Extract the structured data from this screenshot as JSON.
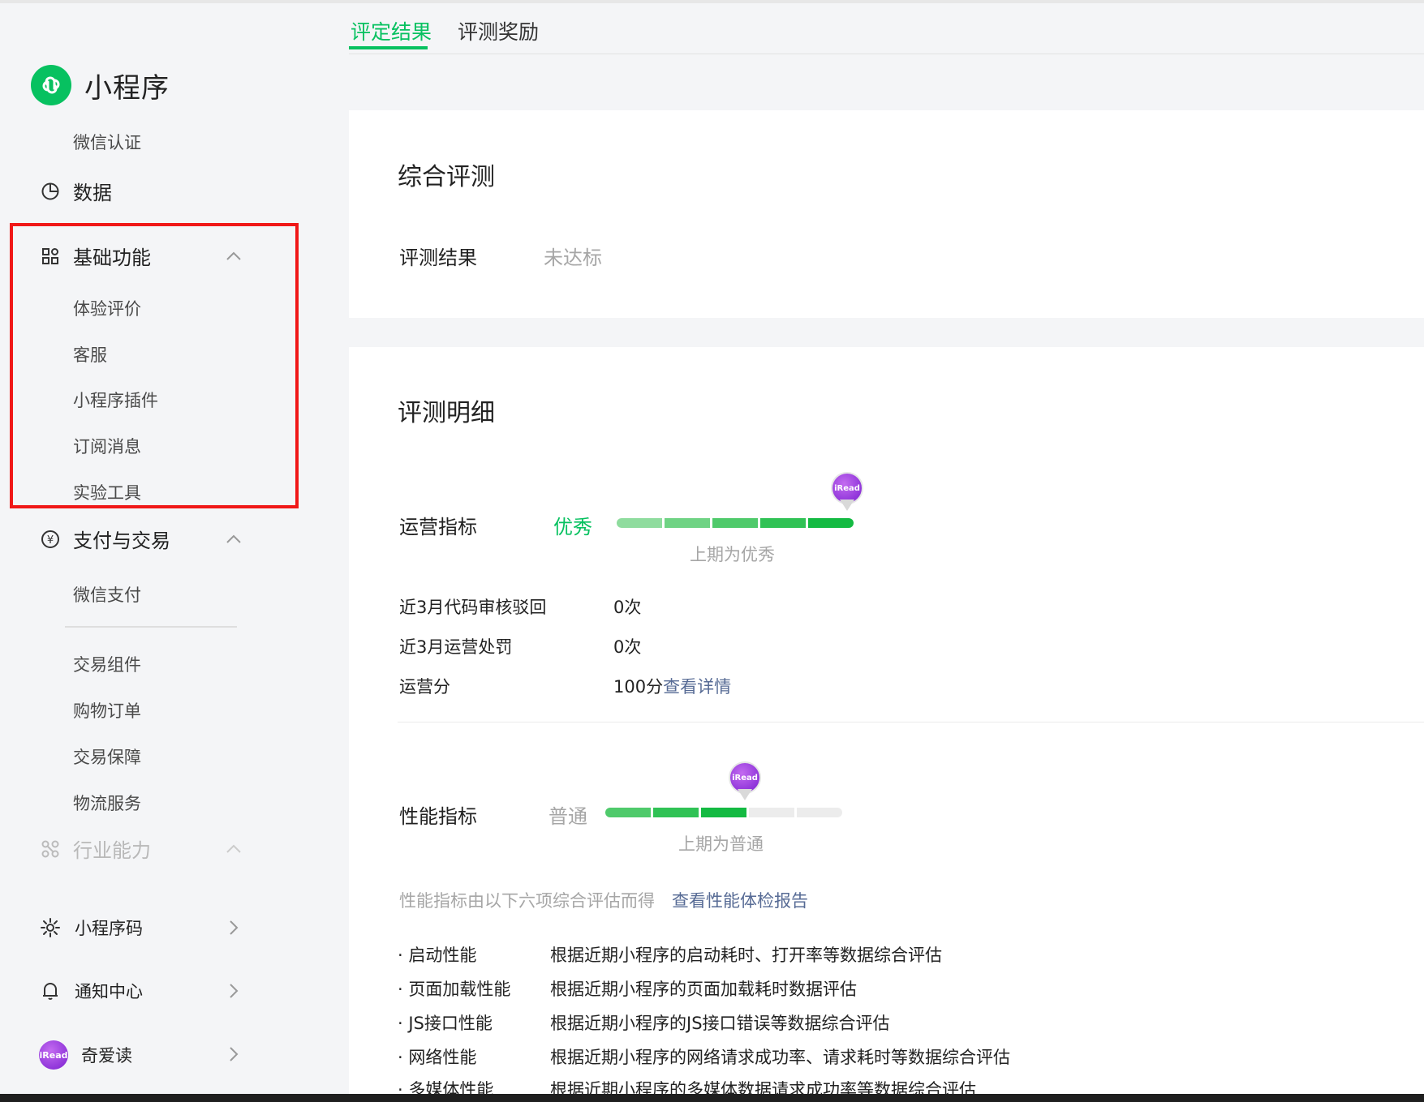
{
  "sidebar": {
    "brand": "小程序",
    "wechat_cert": "微信认证",
    "data_label": "数据",
    "basic_group": "基础功能",
    "basic_items": [
      "体验评价",
      "客服",
      "小程序插件",
      "订阅消息",
      "实验工具"
    ],
    "pay_group": "支付与交易",
    "wechat_pay": "微信支付",
    "pay_items": [
      "交易组件",
      "购物订单",
      "交易保障",
      "物流服务"
    ],
    "industry_group": "行业能力",
    "qrcode": "小程序码",
    "notify": "通知中心",
    "account": "奇爱读",
    "account_avatar_text": "iRead"
  },
  "tabs": [
    "评定结果",
    "评测奖励"
  ],
  "overall": {
    "title": "综合评测",
    "result_label": "评测结果",
    "result_value": "未达标"
  },
  "detail": {
    "title": "评测明细",
    "ops": {
      "label": "运营指标",
      "level": "优秀",
      "last_period": "上期为优秀",
      "filled_segments": 5,
      "total_segments": 5,
      "rows": [
        {
          "label": "近3月代码审核驳回",
          "value": "0次"
        },
        {
          "label": "近3月运营处罚",
          "value": "0次"
        },
        {
          "label": "运营分",
          "value": "100分",
          "link": "查看详情"
        }
      ]
    },
    "perf": {
      "label": "性能指标",
      "level": "普通",
      "last_period": "上期为普通",
      "filled_segments": 3,
      "total_segments": 5,
      "note": "性能指标由以下六项综合评估而得",
      "report_link": "查看性能体检报告",
      "items": [
        {
          "name": "启动性能",
          "desc": "根据近期小程序的启动耗时、打开率等数据综合评估"
        },
        {
          "name": "页面加载性能",
          "desc": "根据近期小程序的页面加载耗时数据评估"
        },
        {
          "name": "JS接口性能",
          "desc": "根据近期小程序的JS接口错误等数据综合评估"
        },
        {
          "name": "网络性能",
          "desc": "根据近期小程序的网络请求成功率、请求耗时等数据综合评估"
        },
        {
          "name": "多媒体性能",
          "desc": "根据近期小程序的多媒体数据请求成功率等数据综合评估"
        }
      ]
    }
  },
  "colors": {
    "accent": "#07c160",
    "link": "#576b95",
    "highlight": "#f01818"
  }
}
